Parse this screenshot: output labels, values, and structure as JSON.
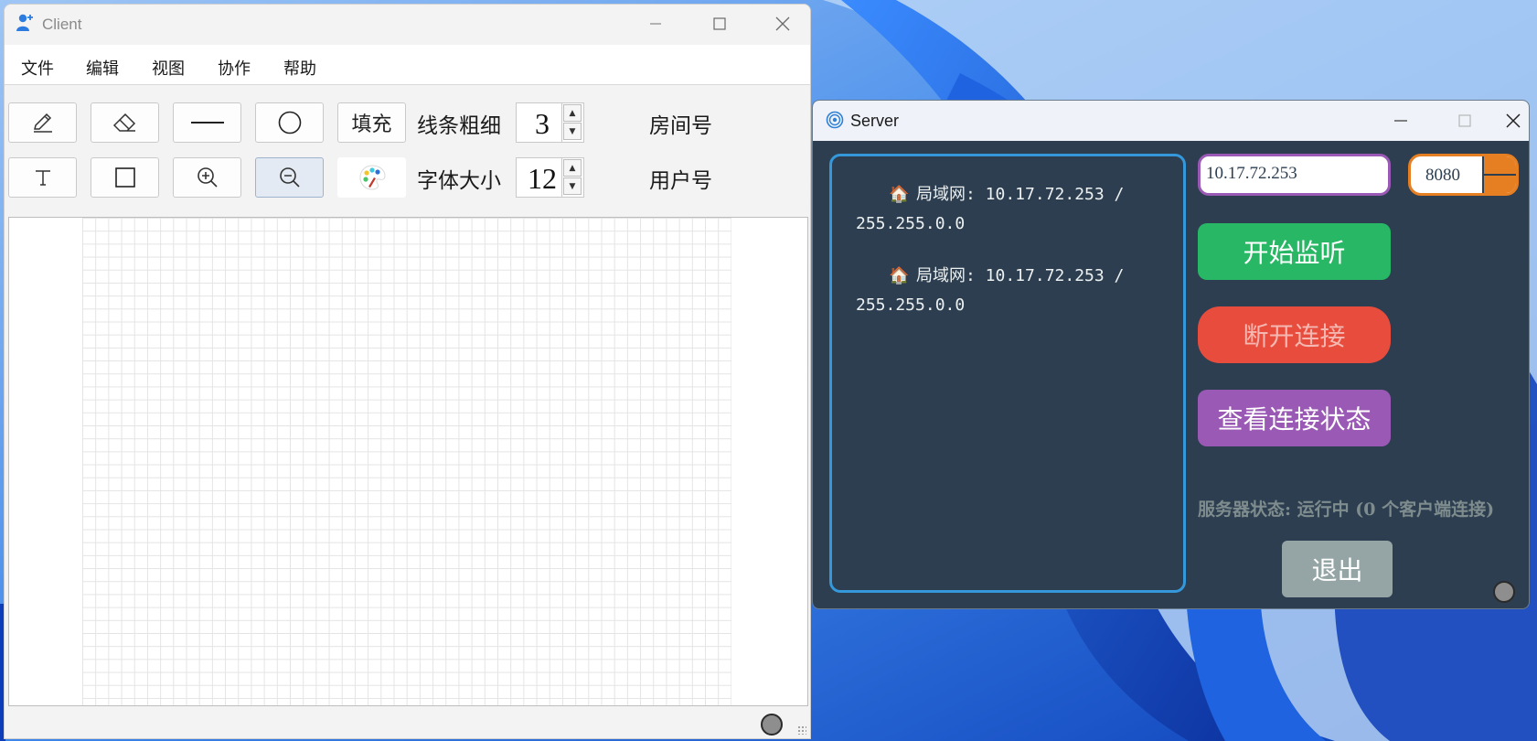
{
  "client": {
    "title": "Client",
    "menu": [
      "文件",
      "编辑",
      "视图",
      "协作",
      "帮助"
    ],
    "tools": {
      "fill_label": "填充",
      "line_width_label": "线条粗细",
      "line_width_value": "3",
      "font_size_label": "字体大小",
      "font_size_value": "12",
      "room_label": "房间号",
      "user_label": "用户号"
    },
    "icons": [
      "pencil-icon",
      "eraser-icon",
      "line-icon",
      "circle-icon",
      "text-icon",
      "rectangle-icon",
      "zoom-in-icon",
      "zoom-out-icon",
      "palette-icon"
    ]
  },
  "server": {
    "title": "Server",
    "interfaces": [
      "局域网: 10.17.72.253 / 255.255.0.0",
      "局域网: 10.17.72.253 / 255.255.0.0"
    ],
    "interface_icon": "house-icon",
    "ip_value": "10.17.72.253",
    "port_value": "8080",
    "buttons": {
      "start": "开始监听",
      "disconnect": "断开连接",
      "view_status": "查看连接状态",
      "exit": "退出"
    },
    "status_text": "服务器状态: 运行中 (0 个客户端连接)",
    "colors": {
      "background": "#2c3e50",
      "panel_border": "#3498db",
      "ip_border": "#9b59b6",
      "port_border": "#e67e22",
      "start": "#27b765",
      "disconnect": "#e74c3c",
      "view_status": "#9b59b6",
      "exit": "#95a5a6"
    }
  }
}
